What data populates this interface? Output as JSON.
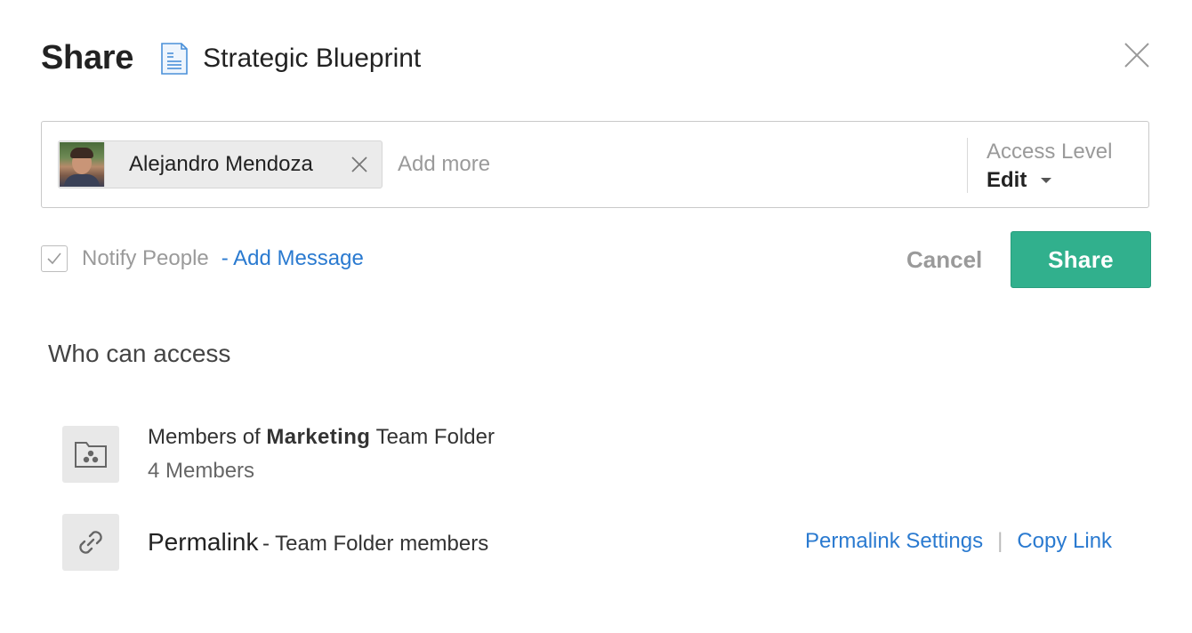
{
  "header": {
    "title": "Share",
    "document_name": "Strategic Blueprint",
    "doc_icon": "document-icon",
    "close_icon": "close-icon"
  },
  "recipients": {
    "chips": [
      {
        "name": "Alejandro Mendoza",
        "avatar": "avatar-photo",
        "remove_icon": "close-icon"
      }
    ],
    "input_placeholder": "Add more",
    "access_level": {
      "label": "Access Level",
      "value": "Edit"
    }
  },
  "notify": {
    "checked": true,
    "label": "Notify People",
    "add_message": "- Add Message"
  },
  "actions": {
    "cancel_label": "Cancel",
    "share_label": "Share",
    "share_color": "#31b08d"
  },
  "who_can_access": {
    "title": "Who can access",
    "items": [
      {
        "prefix": "Members of",
        "bold": "Marketing",
        "suffix": "Team Folder",
        "subtitle": "4 Members",
        "icon": "team-folder-icon"
      },
      {
        "main": "Permalink",
        "sub": "- Team Folder members",
        "icon": "link-icon",
        "settings_link": "Permalink Settings",
        "separator": "|",
        "copy_link": "Copy Link"
      }
    ]
  },
  "colors": {
    "link": "#2a7ad0",
    "muted": "#9a9a9a"
  }
}
